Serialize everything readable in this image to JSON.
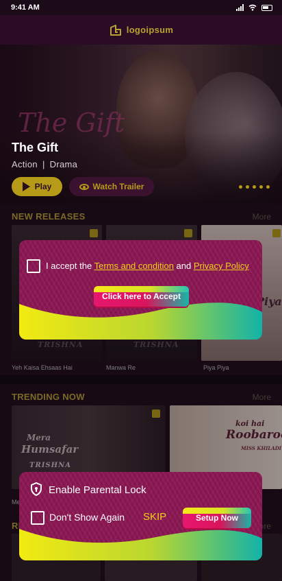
{
  "status_bar": {
    "time": "9:41 AM"
  },
  "app_bar": {
    "logo_text": "logoipsum"
  },
  "hero": {
    "background_title": "The Gift",
    "title": "The Gift",
    "genre_1": "Action",
    "separator": "|",
    "genre_2": "Drama",
    "play_label": "Play",
    "trailer_label": "Watch Trailer",
    "slides": 5
  },
  "new_releases": {
    "title": "NEW RELEASES",
    "more": "More",
    "items": [
      {
        "name": "Yeh Kaisa Ehsaas Hai",
        "poster_text": "TRISHNA"
      },
      {
        "name": "Manwa Re",
        "poster_text": "TRISHNA"
      },
      {
        "name": "Piya Piya",
        "poster_text": "Piya"
      }
    ]
  },
  "trending_now": {
    "title": "TRENDING NOW",
    "more": "More",
    "items": [
      {
        "name": "Me...",
        "poster_title_1": "Mera",
        "poster_title_2": "Humsafar",
        "poster_text": "TRISHNA"
      },
      {
        "name": "",
        "poster_title_1": "koi hai",
        "poster_title_2": "Roobaroo",
        "poster_text": "MISS KHILADI"
      }
    ]
  },
  "third_section": {
    "title": "RI...",
    "more": "More"
  },
  "terms_popup": {
    "prefix": "I accept the ",
    "terms_link": "Terms and condition",
    "middle": " and ",
    "privacy_link": "Privacy Policy",
    "accept_button": "Click here to Accept"
  },
  "parental_popup": {
    "title": "Enable Parental Lock",
    "dont_show": "Don't Show Again",
    "skip": "SKIP",
    "setup_button": "Setup Now"
  },
  "colors": {
    "accent_gold": "#b59b18",
    "popup_magenta": "#8b1753",
    "link_yellow": "#f0d218",
    "button_pink": "#e6176f",
    "button_teal": "#18b6a6"
  }
}
